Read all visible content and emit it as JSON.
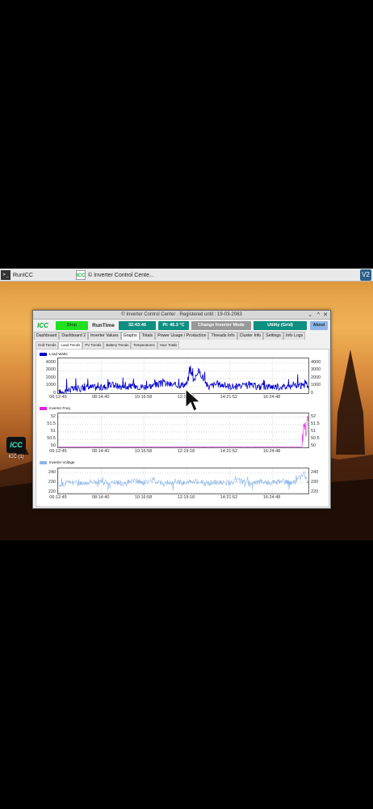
{
  "taskbar": {
    "terminal_label": "RunICC",
    "terminal_icon": ">_",
    "window_label": "© Inverter Control Cente...",
    "window_icon": "ICC",
    "vnc_icon": "V2"
  },
  "desktop": {
    "icon_text": "ICC",
    "icon_label": "ICC (1)"
  },
  "window": {
    "title": "© Inverter Control Center . Registered until : 19-03-2063",
    "controls": [
      "⌄",
      "^",
      "✕"
    ]
  },
  "toolbar": {
    "logo": "ICC",
    "stop": "Stop",
    "runtime_label": "RunTime",
    "runtime_value": "32:43:46",
    "pi_temp": "PI: 46.3 °C",
    "change_mode": "Change Inverter Mode",
    "mode_value": "Utility (Grid)",
    "about": "About"
  },
  "tabs": [
    "Dashboard",
    "Dashboard 2",
    "Inverter Values",
    "Graphs",
    "Totals",
    "Power Usage / Production",
    "Threads Info",
    "Cluster Info",
    "Settings",
    "Info Logs"
  ],
  "active_tab": "Graphs",
  "subtabs": [
    "Grid Trends",
    "Load Trends",
    "PV Trends",
    "Battery Trends",
    "Temperatures",
    "Hour Totals"
  ],
  "active_subtab": "Load Trends",
  "colors": {
    "load_watts": "#0000cc",
    "inverter_freq": "#e020e0",
    "inverter_voltage": "#8ab4e6",
    "accent_teal": "#0f8f80",
    "stop_green": "#20e020"
  },
  "chart_data": [
    {
      "type": "line",
      "series": [
        {
          "name": "Load Watts"
        }
      ],
      "x_ticks": [
        "06:12:45",
        "08:14:40",
        "10:16:58",
        "12:19:18",
        "14:21:52",
        "16:24:48"
      ],
      "y_ticks": [
        "0",
        "1000",
        "2000",
        "3000",
        "4000"
      ],
      "ylim": [
        0,
        4500
      ],
      "x": [
        "06:12:45",
        "06:45",
        "07:15",
        "07:45",
        "08:14:40",
        "08:45",
        "09:15",
        "09:45",
        "10:16:58",
        "10:45",
        "11:15",
        "11:45",
        "12:19:18",
        "12:30",
        "12:40",
        "12:50",
        "13:00",
        "13:20",
        "13:45",
        "14:21:52",
        "14:50",
        "15:20",
        "15:50",
        "16:24:48",
        "16:55",
        "17:25",
        "17:55",
        "18:10"
      ],
      "values": [
        200,
        600,
        700,
        900,
        800,
        1200,
        900,
        1000,
        950,
        1100,
        1400,
        1100,
        1300,
        3200,
        1500,
        3000,
        2600,
        900,
        1300,
        1000,
        950,
        1100,
        900,
        1000,
        900,
        1000,
        1100,
        1000
      ]
    },
    {
      "type": "line",
      "series": [
        {
          "name": "Inverter Freq"
        }
      ],
      "x_ticks": [
        "06:12:45",
        "08:14:40",
        "10:16:58",
        "12:19:18",
        "14:21:52",
        "16:24:48"
      ],
      "y_ticks": [
        "50",
        "50.5",
        "51",
        "51.5",
        "52"
      ],
      "ylim": [
        49.9,
        52.2
      ],
      "x": [
        "06:12:45",
        "08:14:40",
        "10:16:58",
        "12:19:18",
        "14:21:52",
        "16:24:48",
        "17:50",
        "17:55",
        "18:00",
        "18:05",
        "18:10"
      ],
      "values": [
        50.0,
        50.0,
        50.0,
        50.0,
        50.0,
        50.0,
        50.0,
        52.0,
        51.2,
        51.8,
        51.6
      ]
    },
    {
      "type": "line",
      "series": [
        {
          "name": "Inverter Voltage"
        }
      ],
      "x_ticks": [
        "06:12:45",
        "08:14:40",
        "10:16:58",
        "12:19:18",
        "14:21:52",
        "16:24:48"
      ],
      "y_ticks": [
        "220",
        "230",
        "240"
      ],
      "ylim": [
        218,
        244
      ],
      "x": [
        "06:12:45",
        "06:45",
        "07:15",
        "07:45",
        "08:14:40",
        "08:45",
        "09:15",
        "09:45",
        "10:16:58",
        "10:45",
        "11:15",
        "11:45",
        "12:19:18",
        "12:45",
        "13:15",
        "13:45",
        "14:21:52",
        "14:50",
        "15:20",
        "15:50",
        "16:24:48",
        "16:55",
        "17:25",
        "17:55",
        "18:10"
      ],
      "values": [
        227,
        231,
        229,
        232,
        230,
        231,
        229,
        232,
        230,
        233,
        229,
        231,
        230,
        232,
        229,
        231,
        230,
        232,
        229,
        231,
        230,
        231,
        229,
        240,
        226
      ]
    }
  ]
}
